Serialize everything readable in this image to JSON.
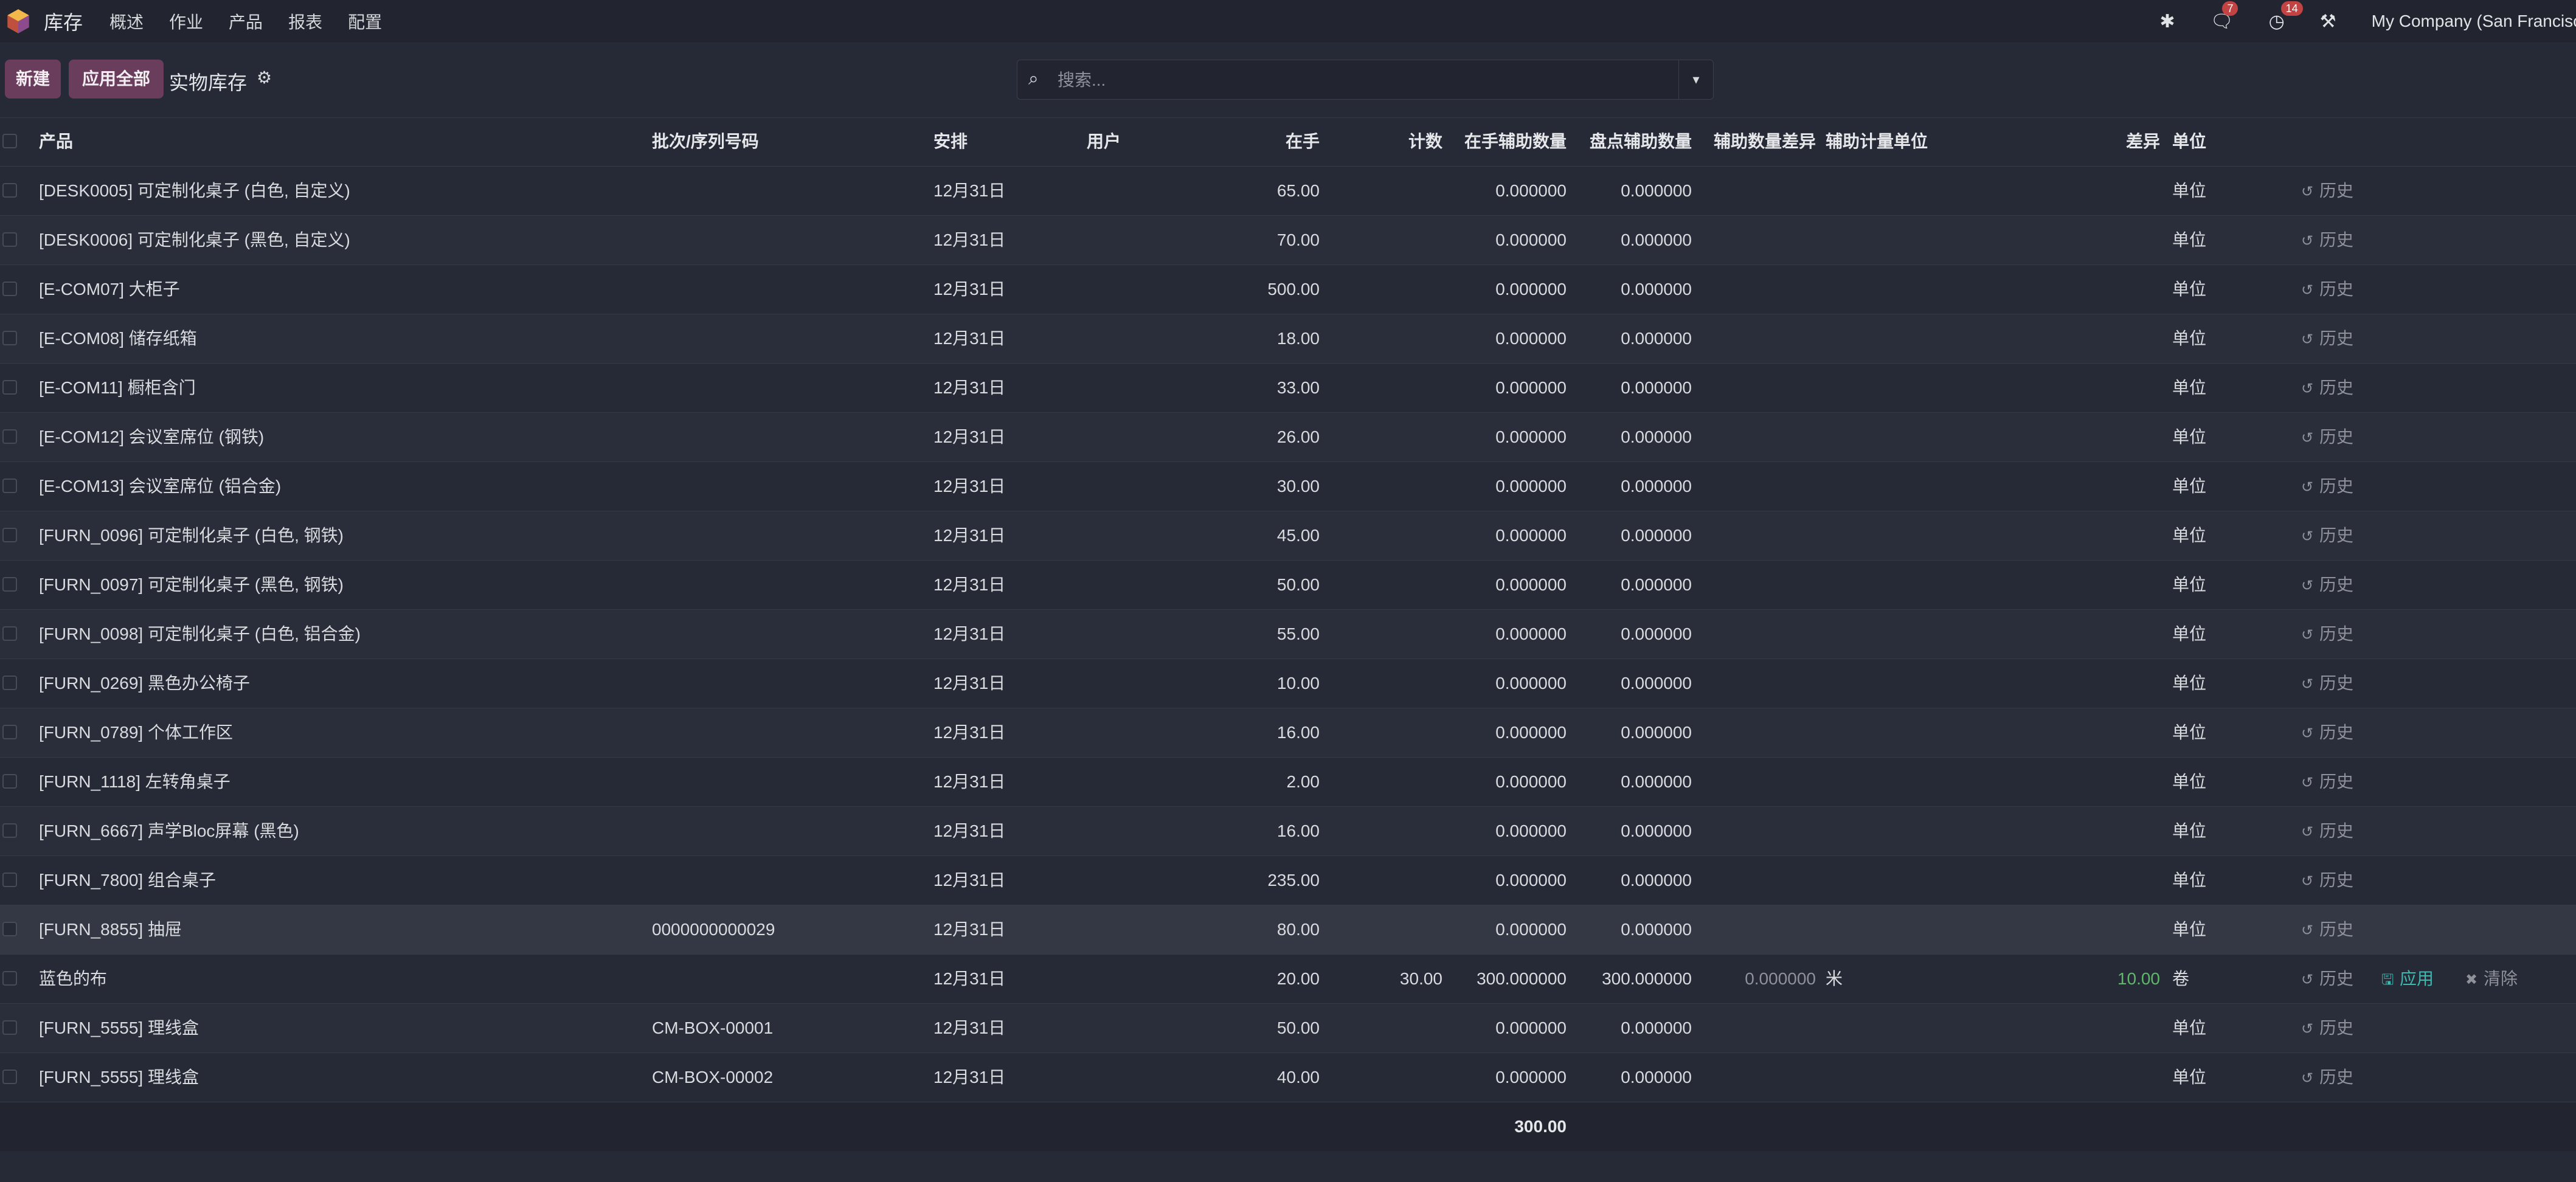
{
  "app": {
    "name": "库存"
  },
  "menu": {
    "items": [
      "概述",
      "作业",
      "产品",
      "报表",
      "配置"
    ]
  },
  "systray": {
    "messages_count": "7",
    "activities_count": "14",
    "company": "My Company (San Francisco)"
  },
  "controls": {
    "new_label": "新建",
    "apply_all_label": "应用全部",
    "view_title": "实物库存",
    "search_placeholder": "搜索..."
  },
  "columns": {
    "product": "产品",
    "lot": "批次/序列号码",
    "scheduled": "安排",
    "user": "用户",
    "on_hand": "在手",
    "count": "计数",
    "on_hand_aux": "在手辅助数量",
    "count_aux": "盘点辅助数量",
    "aux_diff": "辅助数量差异",
    "aux_uom": "辅助计量单位",
    "difference": "差异",
    "uom": "单位"
  },
  "rows": [
    {
      "product": "[DESK0005] 可定制化桌子 (白色, 自定义)",
      "lot": "",
      "scheduled": "12月31日",
      "user": "",
      "on_hand": "65.00",
      "count": "",
      "on_hand_aux": "0.000000",
      "count_aux": "0.000000",
      "aux_diff": "",
      "aux_uom": "",
      "difference": "",
      "uom": "单位",
      "history": "历史"
    },
    {
      "product": "[DESK0006] 可定制化桌子 (黑色, 自定义)",
      "lot": "",
      "scheduled": "12月31日",
      "user": "",
      "on_hand": "70.00",
      "count": "",
      "on_hand_aux": "0.000000",
      "count_aux": "0.000000",
      "aux_diff": "",
      "aux_uom": "",
      "difference": "",
      "uom": "单位",
      "history": "历史"
    },
    {
      "product": "[E-COM07] 大柜子",
      "lot": "",
      "scheduled": "12月31日",
      "user": "",
      "on_hand": "500.00",
      "count": "",
      "on_hand_aux": "0.000000",
      "count_aux": "0.000000",
      "aux_diff": "",
      "aux_uom": "",
      "difference": "",
      "uom": "单位",
      "history": "历史"
    },
    {
      "product": "[E-COM08] 储存纸箱",
      "lot": "",
      "scheduled": "12月31日",
      "user": "",
      "on_hand": "18.00",
      "count": "",
      "on_hand_aux": "0.000000",
      "count_aux": "0.000000",
      "aux_diff": "",
      "aux_uom": "",
      "difference": "",
      "uom": "单位",
      "history": "历史"
    },
    {
      "product": "[E-COM11] 橱柜含门",
      "lot": "",
      "scheduled": "12月31日",
      "user": "",
      "on_hand": "33.00",
      "count": "",
      "on_hand_aux": "0.000000",
      "count_aux": "0.000000",
      "aux_diff": "",
      "aux_uom": "",
      "difference": "",
      "uom": "单位",
      "history": "历史"
    },
    {
      "product": "[E-COM12] 会议室席位 (钢铁)",
      "lot": "",
      "scheduled": "12月31日",
      "user": "",
      "on_hand": "26.00",
      "count": "",
      "on_hand_aux": "0.000000",
      "count_aux": "0.000000",
      "aux_diff": "",
      "aux_uom": "",
      "difference": "",
      "uom": "单位",
      "history": "历史"
    },
    {
      "product": "[E-COM13] 会议室席位 (铝合金)",
      "lot": "",
      "scheduled": "12月31日",
      "user": "",
      "on_hand": "30.00",
      "count": "",
      "on_hand_aux": "0.000000",
      "count_aux": "0.000000",
      "aux_diff": "",
      "aux_uom": "",
      "difference": "",
      "uom": "单位",
      "history": "历史"
    },
    {
      "product": "[FURN_0096] 可定制化桌子 (白色, 钢铁)",
      "lot": "",
      "scheduled": "12月31日",
      "user": "",
      "on_hand": "45.00",
      "count": "",
      "on_hand_aux": "0.000000",
      "count_aux": "0.000000",
      "aux_diff": "",
      "aux_uom": "",
      "difference": "",
      "uom": "单位",
      "history": "历史"
    },
    {
      "product": "[FURN_0097] 可定制化桌子 (黑色, 钢铁)",
      "lot": "",
      "scheduled": "12月31日",
      "user": "",
      "on_hand": "50.00",
      "count": "",
      "on_hand_aux": "0.000000",
      "count_aux": "0.000000",
      "aux_diff": "",
      "aux_uom": "",
      "difference": "",
      "uom": "单位",
      "history": "历史"
    },
    {
      "product": "[FURN_0098] 可定制化桌子 (白色, 铝合金)",
      "lot": "",
      "scheduled": "12月31日",
      "user": "",
      "on_hand": "55.00",
      "count": "",
      "on_hand_aux": "0.000000",
      "count_aux": "0.000000",
      "aux_diff": "",
      "aux_uom": "",
      "difference": "",
      "uom": "单位",
      "history": "历史"
    },
    {
      "product": "[FURN_0269] 黑色办公椅子",
      "lot": "",
      "scheduled": "12月31日",
      "user": "",
      "on_hand": "10.00",
      "count": "",
      "on_hand_aux": "0.000000",
      "count_aux": "0.000000",
      "aux_diff": "",
      "aux_uom": "",
      "difference": "",
      "uom": "单位",
      "history": "历史"
    },
    {
      "product": "[FURN_0789] 个体工作区",
      "lot": "",
      "scheduled": "12月31日",
      "user": "",
      "on_hand": "16.00",
      "count": "",
      "on_hand_aux": "0.000000",
      "count_aux": "0.000000",
      "aux_diff": "",
      "aux_uom": "",
      "difference": "",
      "uom": "单位",
      "history": "历史"
    },
    {
      "product": "[FURN_1118] 左转角桌子",
      "lot": "",
      "scheduled": "12月31日",
      "user": "",
      "on_hand": "2.00",
      "count": "",
      "on_hand_aux": "0.000000",
      "count_aux": "0.000000",
      "aux_diff": "",
      "aux_uom": "",
      "difference": "",
      "uom": "单位",
      "history": "历史"
    },
    {
      "product": "[FURN_6667] 声学Bloc屏幕 (黑色)",
      "lot": "",
      "scheduled": "12月31日",
      "user": "",
      "on_hand": "16.00",
      "count": "",
      "on_hand_aux": "0.000000",
      "count_aux": "0.000000",
      "aux_diff": "",
      "aux_uom": "",
      "difference": "",
      "uom": "单位",
      "history": "历史"
    },
    {
      "product": "[FURN_7800] 组合桌子",
      "lot": "",
      "scheduled": "12月31日",
      "user": "",
      "on_hand": "235.00",
      "count": "",
      "on_hand_aux": "0.000000",
      "count_aux": "0.000000",
      "aux_diff": "",
      "aux_uom": "",
      "difference": "",
      "uom": "单位",
      "history": "历史"
    },
    {
      "product": "[FURN_8855] 抽屉",
      "lot": "0000000000029",
      "scheduled": "12月31日",
      "user": "",
      "on_hand": "80.00",
      "count": "",
      "on_hand_aux": "0.000000",
      "count_aux": "0.000000",
      "aux_diff": "",
      "aux_uom": "",
      "difference": "",
      "uom": "单位",
      "history": "历史"
    },
    {
      "product": "蓝色的布",
      "lot": "",
      "scheduled": "12月31日",
      "user": "",
      "on_hand": "20.00",
      "count": "30.00",
      "on_hand_aux": "300.000000",
      "count_aux": "300.000000",
      "aux_diff": "0.000000",
      "aux_uom": "米",
      "difference": "10.00",
      "uom": "卷",
      "history": "历史",
      "apply": "应用",
      "clear": "清除"
    },
    {
      "product": "[FURN_5555] 理线盒",
      "lot": "CM-BOX-00001",
      "scheduled": "12月31日",
      "user": "",
      "on_hand": "50.00",
      "count": "",
      "on_hand_aux": "0.000000",
      "count_aux": "0.000000",
      "aux_diff": "",
      "aux_uom": "",
      "difference": "",
      "uom": "单位",
      "history": "历史"
    },
    {
      "product": "[FURN_5555] 理线盒",
      "lot": "CM-BOX-00002",
      "scheduled": "12月31日",
      "user": "",
      "on_hand": "40.00",
      "count": "",
      "on_hand_aux": "0.000000",
      "count_aux": "0.000000",
      "aux_diff": "",
      "aux_uom": "",
      "difference": "",
      "uom": "单位",
      "history": "历史"
    }
  ],
  "totals": {
    "on_hand_aux": "300.00"
  },
  "colors": {
    "accent": "#6b3d5d",
    "badge": "#c14343",
    "positive": "#5fb86a",
    "apply": "#3fb8b0"
  }
}
